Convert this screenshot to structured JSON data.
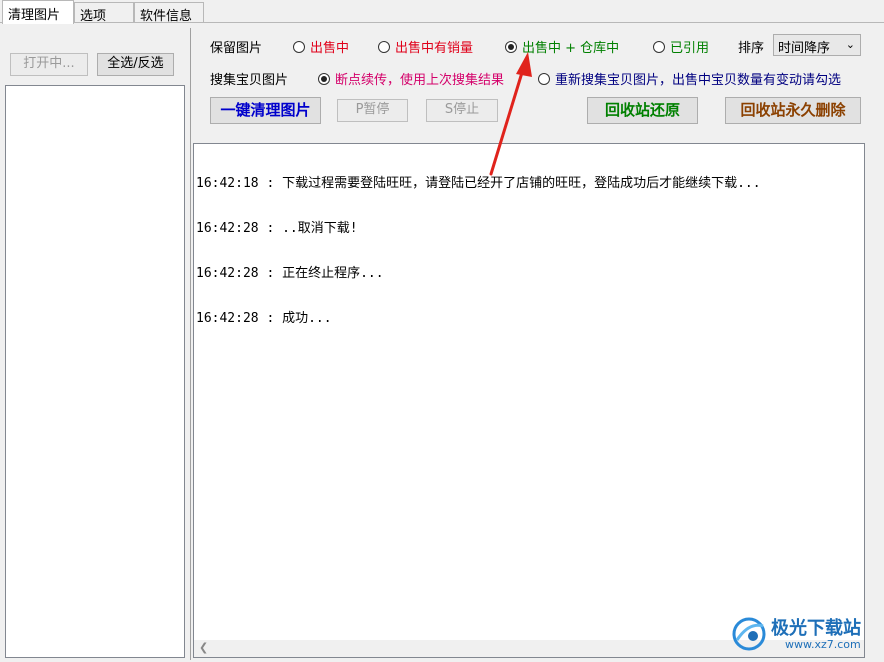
{
  "tabs": [
    "清理图片",
    "选项",
    "软件信息"
  ],
  "left": {
    "open_label": "打开中...",
    "select_all_label": "全选/反选"
  },
  "keep": {
    "label": "保留图片",
    "options": [
      "出售中",
      "出售中有销量",
      "出售中 + 仓库中",
      "已引用"
    ],
    "selected": "出售中 + 仓库中"
  },
  "sort": {
    "label": "排序",
    "value": "时间降序"
  },
  "collect": {
    "label": "搜集宝贝图片",
    "options": [
      "断点续传，使用上次搜集结果",
      "重新搜集宝贝图片，出售中宝贝数量有变动请勾选"
    ],
    "selected": "断点续传，使用上次搜集结果"
  },
  "actions": {
    "clean": "一键清理图片",
    "pause": "P暂停",
    "stop": "S停止",
    "restore": "回收站还原",
    "delete": "回收站永久删除"
  },
  "log_lines": [
    "16:42:18 : 下载过程需要登陆旺旺，请登陆已经开了店铺的旺旺，登陆成功后才能继续下载...",
    "16:42:28 : ..取消下载!",
    "16:42:28 : 正在终止程序...",
    "16:42:28 : 成功..."
  ],
  "watermark": {
    "title": "极光下载站",
    "url": "www.xz7.com"
  },
  "colors": {
    "red": "#e0001a",
    "green": "#008000",
    "magenta": "#d4006a",
    "navy": "#000080",
    "blue": "#0000cc",
    "brown": "#8b4000",
    "arrow": "#e0231c"
  }
}
